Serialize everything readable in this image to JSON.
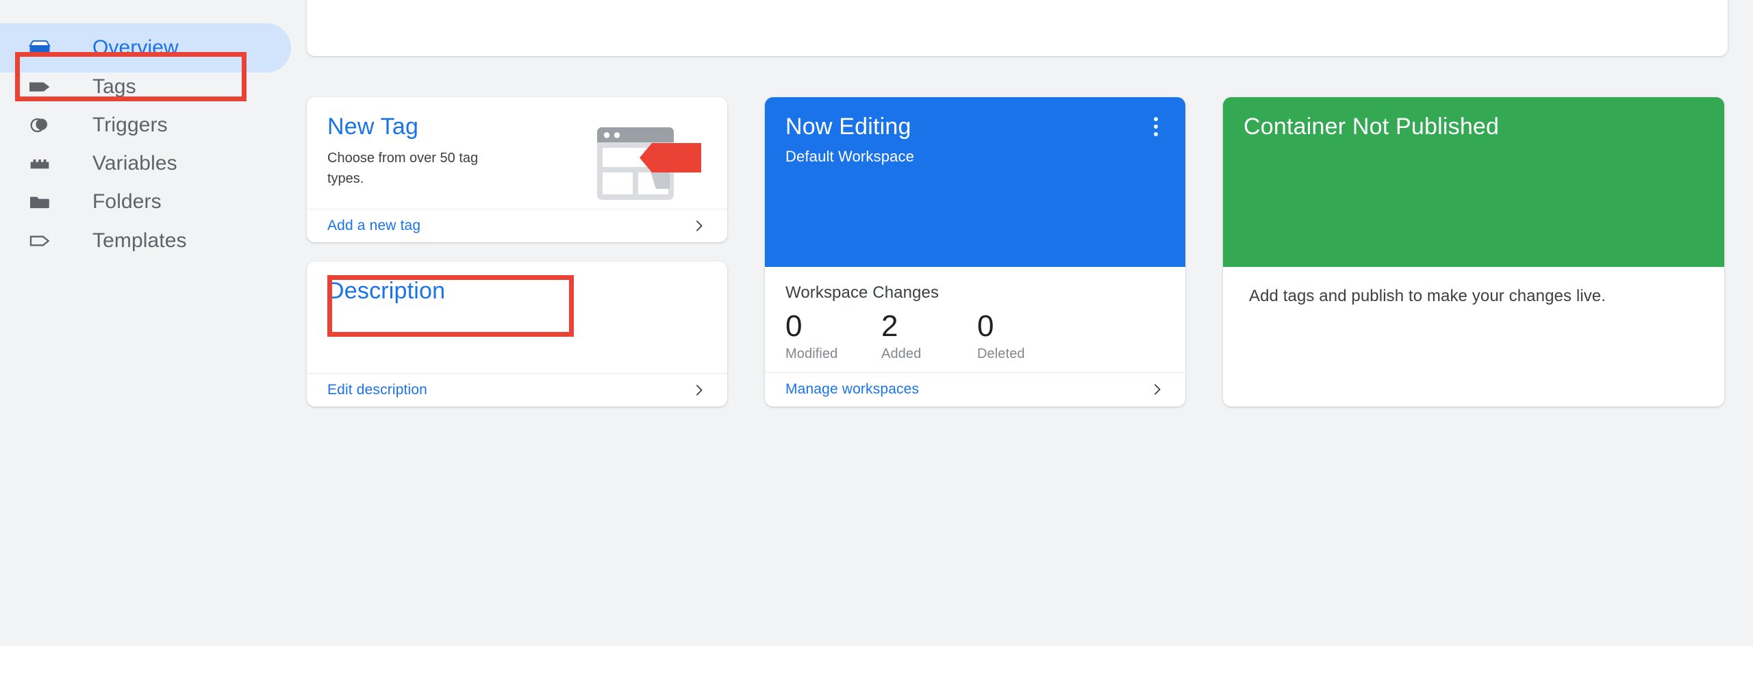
{
  "colors": {
    "accent_blue": "#1a73e8",
    "active_pill": "#d2e3fc",
    "annotation_red": "#ea4335",
    "status_green": "#34a853",
    "page_bg": "#f1f3f4",
    "text_primary": "#3c4043",
    "text_muted": "#80868b"
  },
  "sidebar": {
    "items": [
      {
        "label": "Overview",
        "icon": "container-box-icon",
        "active": true
      },
      {
        "label": "Tags",
        "icon": "tag-filled-icon",
        "active": false
      },
      {
        "label": "Triggers",
        "icon": "trigger-circles-icon",
        "active": false
      },
      {
        "label": "Variables",
        "icon": "variable-block-icon",
        "active": false
      },
      {
        "label": "Folders",
        "icon": "folder-icon",
        "active": false
      },
      {
        "label": "Templates",
        "icon": "tag-outline-icon",
        "active": false
      }
    ]
  },
  "annotations": [
    {
      "name": "overview-highlight",
      "target": "sidebar-item-overview"
    },
    {
      "name": "add-a-new-tag-highlight",
      "target": "add-a-new-tag-link"
    }
  ],
  "cards": {
    "new_tag": {
      "title": "New Tag",
      "subtitle": "Choose from over 50 tag types.",
      "footer_link": "Add a new tag",
      "chevron": "chevron-right-icon",
      "illustration": "browser-window-with-tag-icon"
    },
    "description": {
      "title": "Description",
      "body": "",
      "footer_link": "Edit description",
      "chevron": "chevron-right-icon"
    },
    "now_editing": {
      "title": "Now Editing",
      "subtitle": "Default Workspace",
      "menu_icon": "more-vert-icon",
      "changes_heading": "Workspace Changes",
      "stats": [
        {
          "value": "0",
          "label": "Modified"
        },
        {
          "value": "2",
          "label": "Added"
        },
        {
          "value": "0",
          "label": "Deleted"
        }
      ],
      "footer_link": "Manage workspaces",
      "chevron": "chevron-right-icon"
    },
    "container_not_published": {
      "title": "Container Not Published",
      "body": "Add tags and publish to make your changes live."
    }
  }
}
